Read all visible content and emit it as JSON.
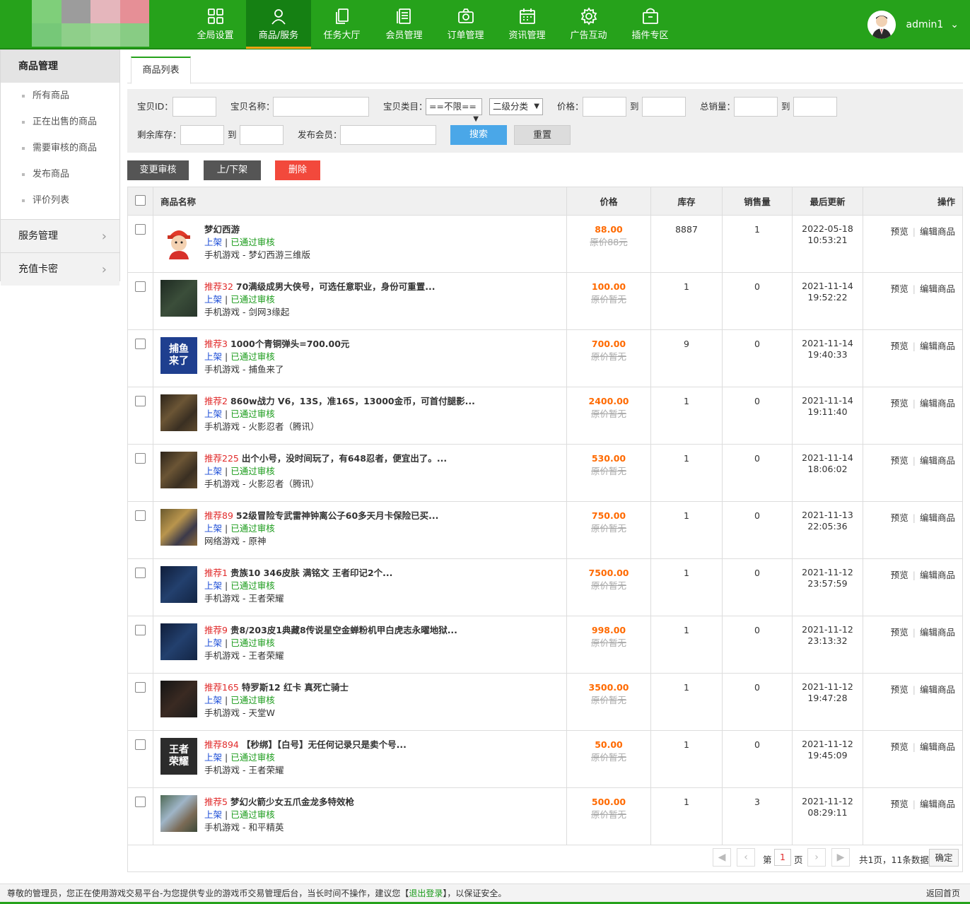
{
  "header": {
    "nav": [
      {
        "label": "全局设置",
        "icon": "grid-icon"
      },
      {
        "label": "商品/服务",
        "icon": "user-icon"
      },
      {
        "label": "任务大厅",
        "icon": "copy-icon"
      },
      {
        "label": "会员管理",
        "icon": "list-icon"
      },
      {
        "label": "订单管理",
        "icon": "camera-icon"
      },
      {
        "label": "资讯管理",
        "icon": "calendar-icon"
      },
      {
        "label": "广告互动",
        "icon": "gear-icon"
      },
      {
        "label": "插件专区",
        "icon": "bag-icon"
      }
    ],
    "active_nav": "商品/服务",
    "username": "admin1",
    "colors": {
      "primary": "#26a21b",
      "active": "#158013",
      "accent": "#f3a314"
    }
  },
  "sidebar": {
    "section": "商品管理",
    "items": [
      "所有商品",
      "正在出售的商品",
      "需要审核的商品",
      "发布商品",
      "评价列表"
    ],
    "groups": [
      "服务管理",
      "充值卡密"
    ]
  },
  "tab": "商品列表",
  "filters": {
    "id_label": "宝贝ID：",
    "name_label": "宝贝名称：",
    "category_label": "宝贝类目：",
    "category_value": "==不限==",
    "subcategory_value": "二级分类",
    "price_label": "价格：",
    "to": "到",
    "sales_label": "总销量：",
    "stock_label": "剩余库存：",
    "member_label": "发布会员：",
    "search_btn": "搜索",
    "reset_btn": "重置"
  },
  "actions": {
    "review": "变更审核",
    "shelf": "上/下架",
    "delete": "删除"
  },
  "table": {
    "columns": [
      "商品名称",
      "价格",
      "库存",
      "销售量",
      "最后更新",
      "操作"
    ],
    "op_preview": "预览",
    "op_edit": "编辑商品",
    "rows": [
      {
        "tag": "",
        "title": "梦幻西游",
        "status_shelf": "上架",
        "status_review": "已通过审核",
        "category": "手机游戏 - 梦幻西游三维版",
        "price": "88.00",
        "orig": "原价88元",
        "stock": "8887",
        "sales": "1",
        "date": "2022-05-18",
        "time": "10:53:21",
        "thumb": "avatar"
      },
      {
        "tag": "推荐32",
        "title": "70满级成男大侠号，可选任意职业，身份可重置...",
        "status_shelf": "上架",
        "status_review": "已通过审核",
        "category": "手机游戏 - 剑网3缘起",
        "price": "100.00",
        "orig": "原价暂无",
        "stock": "1",
        "sales": "0",
        "date": "2021-11-14",
        "time": "19:52:22",
        "thumb": "dark-green"
      },
      {
        "tag": "推荐3",
        "title": "1000个青铜弹头=700.00元",
        "status_shelf": "上架",
        "status_review": "已通过审核",
        "category": "手机游戏 - 捕鱼来了",
        "price": "700.00",
        "orig": "原价暂无",
        "stock": "9",
        "sales": "0",
        "date": "2021-11-14",
        "time": "19:40:33",
        "thumb": "text-blue",
        "thumb_text": [
          "捕鱼",
          "来了"
        ]
      },
      {
        "tag": "推荐2",
        "title": "860w战力 V6，13S，准16S，13000金币，可首付腿影...",
        "status_shelf": "上架",
        "status_review": "已通过审核",
        "category": "手机游戏 - 火影忍者（腾讯）",
        "price": "2400.00",
        "orig": "原价暂无",
        "stock": "1",
        "sales": "0",
        "date": "2021-11-14",
        "time": "19:11:40",
        "thumb": "dark-brown"
      },
      {
        "tag": "推荐225",
        "title": "出个小号，没时间玩了，有648忍者，便宜出了。...",
        "status_shelf": "上架",
        "status_review": "已通过审核",
        "category": "手机游戏 - 火影忍者（腾讯）",
        "price": "530.00",
        "orig": "原价暂无",
        "stock": "1",
        "sales": "0",
        "date": "2021-11-14",
        "time": "18:06:02",
        "thumb": "dark-brown"
      },
      {
        "tag": "推荐89",
        "title": "52级冒险专武雷神钟离公子60多天月卡保险已买...",
        "status_shelf": "上架",
        "status_review": "已通过审核",
        "category": "网络游戏 - 原神",
        "price": "750.00",
        "orig": "原价暂无",
        "stock": "1",
        "sales": "0",
        "date": "2021-11-13",
        "time": "22:05:36",
        "thumb": "gold"
      },
      {
        "tag": "推荐1",
        "title": "贵族10 346皮肤 满铭文 王者印记2个...",
        "status_shelf": "上架",
        "status_review": "已通过审核",
        "category": "手机游戏 - 王者荣耀",
        "price": "7500.00",
        "orig": "原价暂无",
        "stock": "1",
        "sales": "0",
        "date": "2021-11-12",
        "time": "23:57:59",
        "thumb": "navy"
      },
      {
        "tag": "推荐9",
        "title": "贵8/203皮1典藏8传说星空金蝉粉机甲白虎志永曜地狱...",
        "status_shelf": "上架",
        "status_review": "已通过审核",
        "category": "手机游戏 - 王者荣耀",
        "price": "998.00",
        "orig": "原价暂无",
        "stock": "1",
        "sales": "0",
        "date": "2021-11-12",
        "time": "23:13:32",
        "thumb": "navy"
      },
      {
        "tag": "推荐165",
        "title": "特罗斯12 红卡 真死亡骑士",
        "status_shelf": "上架",
        "status_review": "已通过审核",
        "category": "手机游戏 - 天堂W",
        "price": "3500.00",
        "orig": "原价暂无",
        "stock": "1",
        "sales": "0",
        "date": "2021-11-12",
        "time": "19:47:28",
        "thumb": "black"
      },
      {
        "tag": "推荐894",
        "title": "【秒绑】【白号】无任何记录只是卖个号...",
        "status_shelf": "上架",
        "status_review": "已通过审核",
        "category": "手机游戏 - 王者荣耀",
        "price": "50.00",
        "orig": "原价暂无",
        "stock": "1",
        "sales": "0",
        "date": "2021-11-12",
        "time": "19:45:09",
        "thumb": "text-dark",
        "thumb_text": [
          "王者",
          "荣耀"
        ]
      },
      {
        "tag": "推荐5",
        "title": "梦幻火箭少女五爪金龙多特效枪",
        "status_shelf": "上架",
        "status_review": "已通过审核",
        "category": "手机游戏 - 和平精英",
        "price": "500.00",
        "orig": "原价暂无",
        "stock": "1",
        "sales": "3",
        "date": "2021-11-12",
        "time": "08:29:11",
        "thumb": "scene"
      }
    ]
  },
  "pager": {
    "prefix": "第",
    "page": "1",
    "suffix": "页",
    "summary": "共1页，11条数据",
    "confirm": "确定"
  },
  "footer": {
    "text1": "尊敬的管理员，您正在使用游戏交易平台-为您提供专业的游戏币交易管理后台，当长时间不操作，建议您【",
    "logout": "退出登录",
    "text2": "】，以保证安全。",
    "home": "返回首页"
  }
}
